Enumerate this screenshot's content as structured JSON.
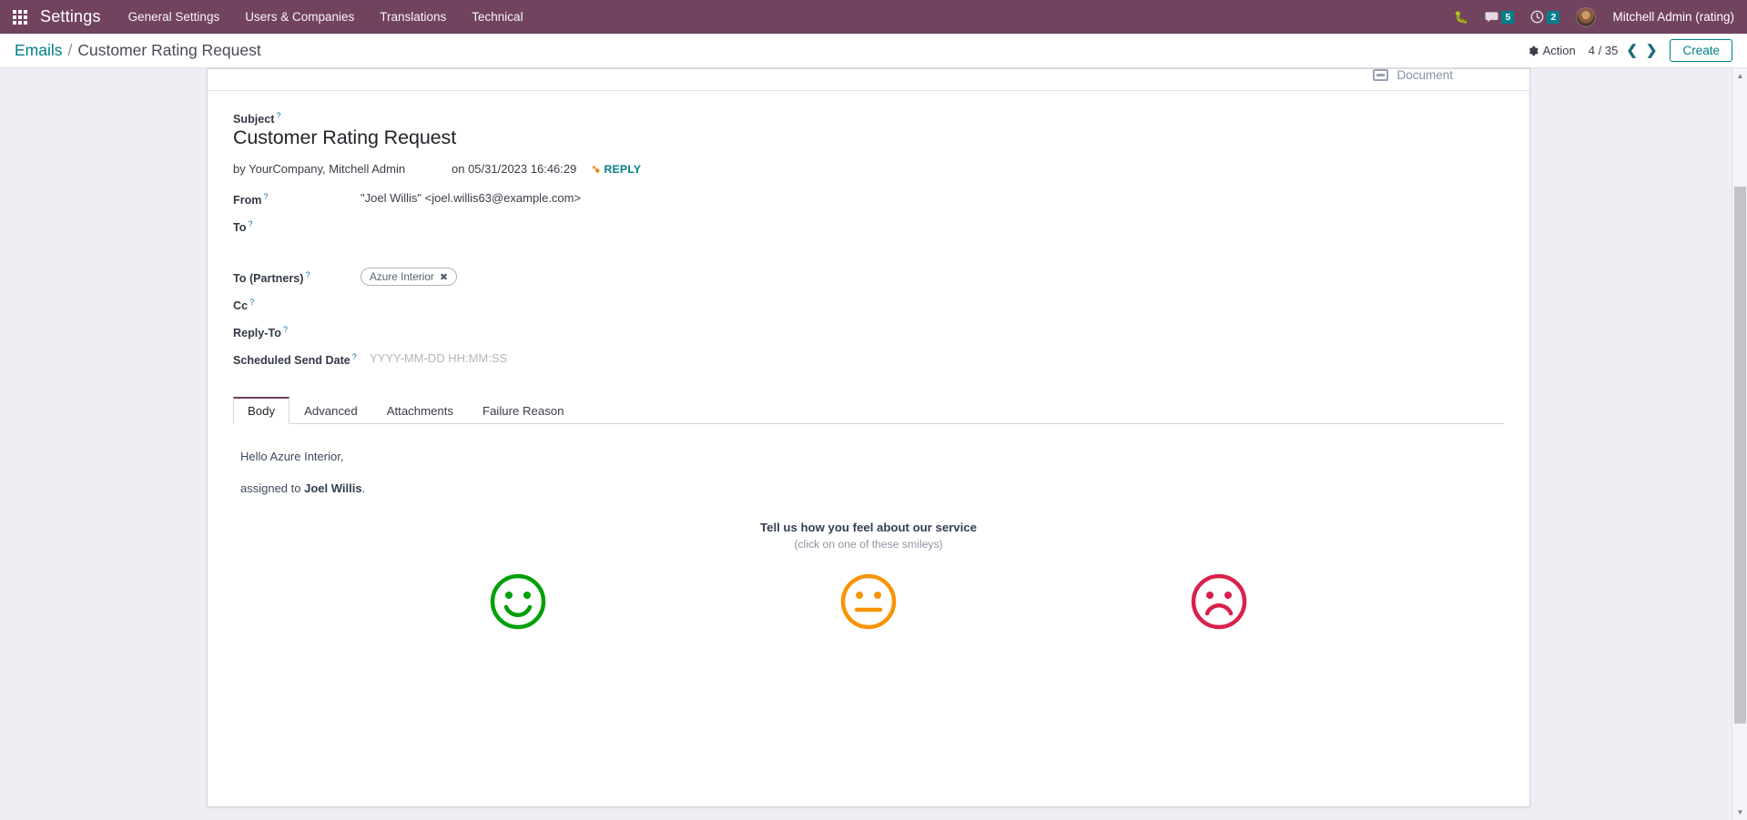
{
  "navbar": {
    "apps_icon": "apps-grid-icon",
    "brand": "Settings",
    "menu": [
      {
        "label": "General Settings"
      },
      {
        "label": "Users & Companies"
      },
      {
        "label": "Translations"
      },
      {
        "label": "Technical"
      }
    ],
    "bug_icon": "bug-icon",
    "messages_icon": "chat-bubble-icon",
    "messages_count": "5",
    "activities_icon": "clock-icon",
    "activities_count": "2",
    "avatar": "user-avatar",
    "user_name": "Mitchell Admin (rating)"
  },
  "control_panel": {
    "breadcrumb_root": "Emails",
    "breadcrumb_separator": "/",
    "breadcrumb_current": "Customer Rating Request",
    "action_label": "Action",
    "action_icon": "gear-icon",
    "pager": "4 / 35",
    "prev_icon": "chevron-left-icon",
    "next_icon": "chevron-right-icon",
    "create_label": "Create"
  },
  "stat_button": {
    "icon": "document-icon",
    "label": "Document"
  },
  "record": {
    "subject_label": "Subject",
    "subject_value": "Customer Rating Request",
    "author": "by YourCompany, Mitchell Admin",
    "date": "on 05/31/2023 16:46:29",
    "reply_label": "REPLY",
    "reply_icon": "reply-arrow-icon",
    "fields": [
      {
        "label": "From",
        "value": "\"Joel Willis\" <joel.willis63@example.com>",
        "placeholder": "",
        "type": "text"
      },
      {
        "label": "To",
        "value": "",
        "placeholder": "",
        "type": "text"
      },
      {
        "label": "To (Partners)",
        "value": "",
        "placeholder": "",
        "type": "tags",
        "tags": [
          {
            "label": "Azure Interior",
            "remove_icon": "close-icon"
          }
        ]
      },
      {
        "label": "Cc",
        "value": "",
        "placeholder": "",
        "type": "text"
      },
      {
        "label": "Reply-To",
        "value": "",
        "placeholder": "",
        "type": "text"
      },
      {
        "label": "Scheduled Send Date",
        "value": "",
        "placeholder": "YYYY-MM-DD HH:MM:SS",
        "type": "text"
      }
    ],
    "help_marker": "?"
  },
  "notebook": {
    "tabs": [
      {
        "label": "Body",
        "active": true
      },
      {
        "label": "Advanced",
        "active": false
      },
      {
        "label": "Attachments",
        "active": false
      },
      {
        "label": "Failure Reason",
        "active": false
      }
    ]
  },
  "email_body": {
    "greeting": "Hello Azure Interior,",
    "assigned_prefix": "assigned to ",
    "assigned_name": "Joel Willis",
    "assigned_suffix": ".",
    "rating_title": "Tell us how you feel about our service",
    "rating_subtitle": "(click on one of these smileys)",
    "smileys": [
      {
        "name": "happy-smiley",
        "color": "#00a009",
        "mood": "happy"
      },
      {
        "name": "neutral-smiley",
        "color": "#f89406",
        "mood": "neutral"
      },
      {
        "name": "sad-smiley",
        "color": "#d9214a",
        "mood": "sad"
      }
    ]
  },
  "colors": {
    "navbar_bg": "#71435f",
    "accent_teal": "#00808a",
    "page_bg": "#f0eef4",
    "tab_active_border": "#71435f"
  },
  "scrollbar": {
    "up_arrow": "▲",
    "down_arrow": "▼"
  }
}
